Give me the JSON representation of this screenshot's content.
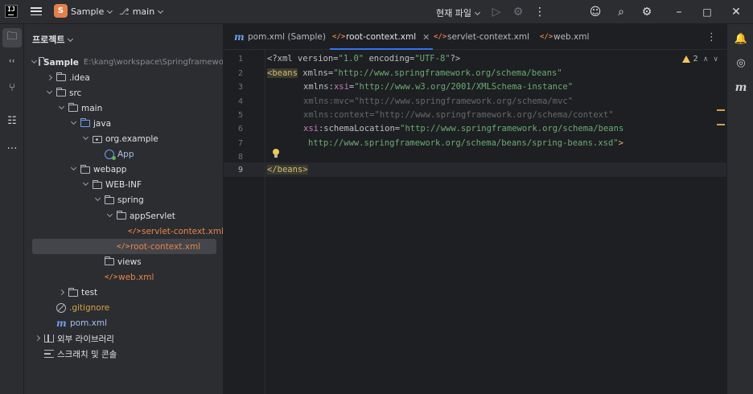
{
  "titlebar": {
    "logo_text": "IJ",
    "project_badge": "S",
    "project_name": "Sample",
    "branch": "main",
    "run_config": "현재 파일"
  },
  "project_panel": {
    "title": "프로젝트",
    "tree": [
      {
        "label": "Sample",
        "hint": "E:\\kang\\workspace\\Springframework",
        "icon": "module-folder-icon",
        "arrow": "open",
        "indent": 0,
        "bold": true
      },
      {
        "label": ".idea",
        "icon": "folder-icon",
        "arrow": "closed",
        "indent": 1
      },
      {
        "label": "src",
        "icon": "folder-icon",
        "arrow": "open",
        "indent": 1
      },
      {
        "label": "main",
        "icon": "folder-icon",
        "arrow": "open",
        "indent": 2
      },
      {
        "label": "java",
        "icon": "source-folder-icon",
        "arrow": "open",
        "indent": 3
      },
      {
        "label": "org.example",
        "icon": "package-icon",
        "arrow": "open",
        "indent": 4
      },
      {
        "label": "App",
        "icon": "class-icon",
        "arrow": "none",
        "indent": 5
      },
      {
        "label": "webapp",
        "icon": "folder-icon",
        "arrow": "open",
        "indent": 3
      },
      {
        "label": "WEB-INF",
        "icon": "folder-icon",
        "arrow": "open",
        "indent": 4
      },
      {
        "label": "spring",
        "icon": "folder-icon",
        "arrow": "open",
        "indent": 5
      },
      {
        "label": "appServlet",
        "icon": "folder-icon",
        "arrow": "open",
        "indent": 6
      },
      {
        "label": "servlet-context.xml",
        "icon": "xml-icon",
        "arrow": "none",
        "indent": 7
      },
      {
        "label": "root-context.xml",
        "icon": "xml-icon",
        "arrow": "none",
        "indent": 6,
        "selected": true
      },
      {
        "label": "views",
        "icon": "folder-icon",
        "arrow": "none",
        "indent": 5
      },
      {
        "label": "web.xml",
        "icon": "xml-icon",
        "arrow": "none",
        "indent": 5
      },
      {
        "label": "test",
        "icon": "folder-icon",
        "arrow": "closed",
        "indent": 2
      },
      {
        "label": ".gitignore",
        "icon": "ignore-file-icon",
        "arrow": "none",
        "indent": 1
      },
      {
        "label": "pom.xml",
        "icon": "maven-icon",
        "arrow": "none",
        "indent": 1
      },
      {
        "label": "외부 라이브러리",
        "icon": "library-icon",
        "arrow": "closed",
        "indent": 0
      },
      {
        "label": "스크래치 및 콘솔",
        "icon": "scratch-icon",
        "arrow": "none",
        "indent": 0
      }
    ]
  },
  "editor": {
    "tabs": [
      {
        "label": "pom.xml (Sample)",
        "icon": "maven-icon"
      },
      {
        "label": "root-context.xml",
        "icon": "xml-icon",
        "active": true
      },
      {
        "label": "servlet-context.xml",
        "icon": "xml-icon"
      },
      {
        "label": "web.xml",
        "icon": "xml-icon"
      }
    ],
    "warning_count": "2",
    "line_numbers": [
      "1",
      "2",
      "3",
      "4",
      "5",
      "6",
      "7",
      "8",
      "9"
    ],
    "code": {
      "l1": [
        "<?xml version=",
        "\"1.0\"",
        " encoding=",
        "\"UTF-8\"",
        "?>"
      ],
      "l2": [
        "<beans",
        " xmlns=",
        "\"http://www.springframework.org/schema/beans\""
      ],
      "l3": [
        "xmlns:",
        "xsi",
        "=",
        "\"http://www.w3.org/2001/XMLSchema-instance\""
      ],
      "l4": [
        "xmlns:mvc=",
        "\"http://www.springframework.org/schema/mvc\""
      ],
      "l5": [
        "xmlns:context=",
        "\"http://www.springframework.org/schema/context\""
      ],
      "l6": [
        "xsi",
        ":schemaLocation=",
        "\"http://www.springframework.org/schema/beans"
      ],
      "l7": [
        "http://www.springframework.org/schema/beans/spring-beans.xsd\"",
        ">"
      ],
      "l9": [
        "</beans>"
      ]
    }
  }
}
